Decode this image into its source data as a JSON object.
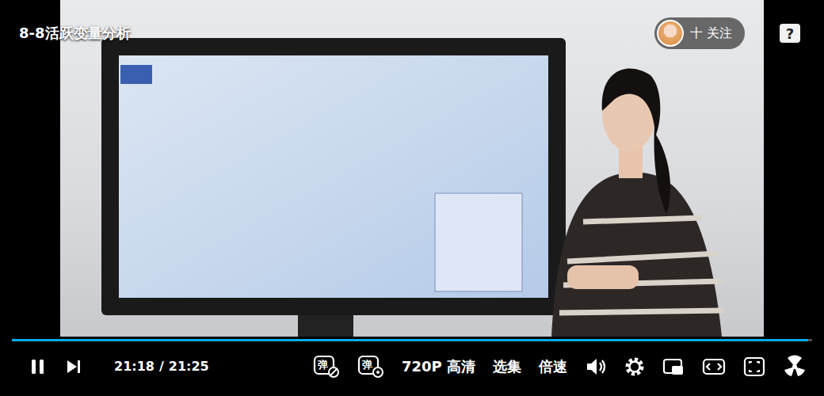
{
  "video": {
    "title": "8-8活跃变量分析"
  },
  "follow_button": {
    "label": "十 关注"
  },
  "help": {
    "label": "?"
  },
  "progress": {
    "level": 0.995
  },
  "player": {
    "playing": true
  },
  "time": {
    "current": "21:18",
    "separator": "/",
    "total": "21:25"
  },
  "controls": {
    "danmaku_toggle": "弹",
    "danmaku_settings": "弹",
    "quality": "720P 高清",
    "episodes": "选集",
    "speed": "倍速"
  }
}
